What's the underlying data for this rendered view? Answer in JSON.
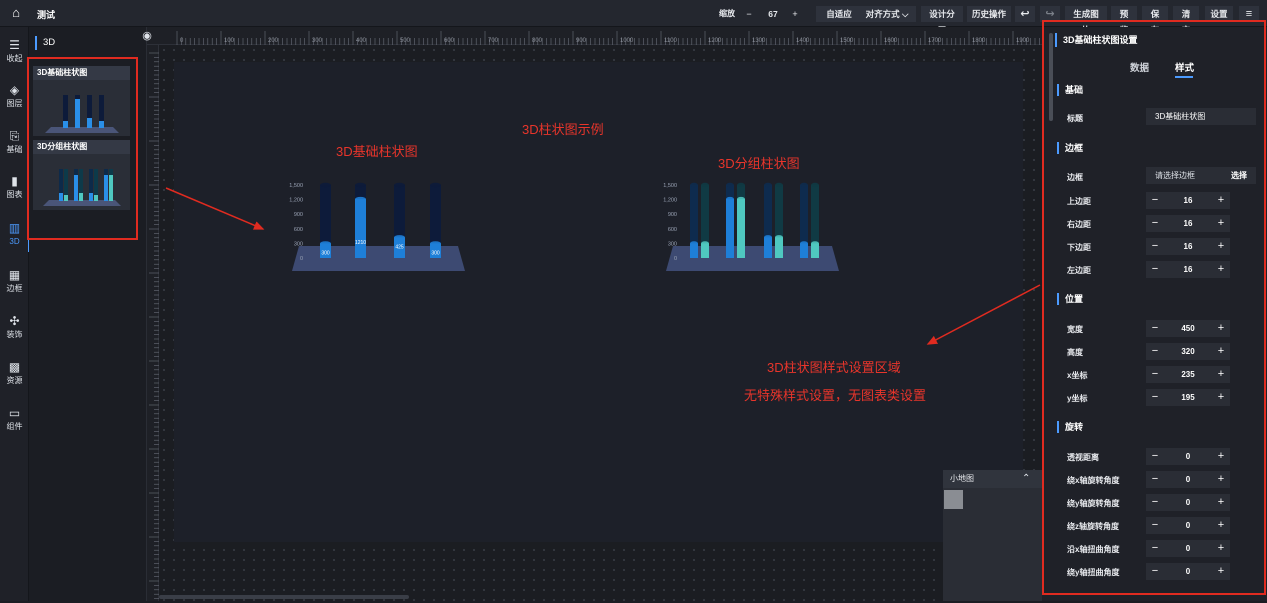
{
  "app": {
    "title": "测试"
  },
  "toolbar": {
    "zoom_label": "缩放",
    "zoom_minus": "−",
    "zoom_value": "67",
    "zoom_plus": "+",
    "fit": "自适应",
    "align": "对齐方式",
    "align_arrow": "⌵",
    "design_split": "设计分工",
    "history": "历史操作",
    "undo_glyph": "↩",
    "redo_glyph": "↪",
    "gen_image": "生成图片",
    "preview": "预览",
    "save": "保存",
    "clear": "清空",
    "settings": "设置",
    "menu_glyph": "≡"
  },
  "nav": [
    {
      "icon": "collapse-icon",
      "glyph": "☰",
      "label": "收起"
    },
    {
      "icon": "layers-icon",
      "glyph": "◈",
      "label": "图层"
    },
    {
      "icon": "basic-icon",
      "glyph": "⎘",
      "label": "基础"
    },
    {
      "icon": "chart-icon",
      "glyph": "▮",
      "label": "图表"
    },
    {
      "icon": "3d-icon",
      "glyph": "▥",
      "label": "3D"
    },
    {
      "icon": "border-icon",
      "glyph": "▦",
      "label": "边框"
    },
    {
      "icon": "decoration-icon",
      "glyph": "✣",
      "label": "装饰"
    },
    {
      "icon": "resource-icon",
      "glyph": "▩",
      "label": "资源"
    },
    {
      "icon": "component-icon",
      "glyph": "▭",
      "label": "组件"
    }
  ],
  "component_panel": {
    "heading": "3D",
    "cards": [
      {
        "title": "3D基础柱状图"
      },
      {
        "title": "3D分组柱状图"
      }
    ]
  },
  "ruler": {
    "top_ticks": [
      "0",
      "100",
      "200",
      "300",
      "400",
      "500",
      "600",
      "700",
      "800",
      "900",
      "1000",
      "1100",
      "1200",
      "1300",
      "1400",
      "1500",
      "1600",
      "1700",
      "1800",
      "1900"
    ]
  },
  "canvas": {
    "annotation_main": "3D柱状图示例",
    "label_basic": "3D基础柱状图",
    "label_grouped": "3D分组柱状图",
    "annotation_style_area": "3D柱状图样式设置区域",
    "annotation_note": "无特殊样式设置，无图表类设置"
  },
  "chart_data": [
    {
      "type": "bar",
      "categories": [
        "",
        "",
        "",
        ""
      ],
      "values": [
        300,
        1210,
        425,
        300
      ],
      "value_labels": [
        "300",
        "1210",
        "425",
        "300"
      ],
      "ylim": [
        0,
        1500
      ],
      "yticks": [
        "1,500",
        "1,200",
        "900",
        "600",
        "300",
        "0"
      ]
    },
    {
      "type": "bar",
      "categories": [
        "",
        "",
        "",
        ""
      ],
      "series": [
        {
          "values": [
            300,
            1210,
            425,
            300
          ]
        },
        {
          "values": [
            300,
            1210,
            425,
            300
          ]
        }
      ],
      "ylim": [
        0,
        1500
      ],
      "yticks": [
        "1,500",
        "1,200",
        "900",
        "600",
        "300",
        "0"
      ]
    }
  ],
  "minimap": {
    "title": "小地图",
    "toggle_glyph": "⌃"
  },
  "settings_panel": {
    "title": "3D基础柱状图设置",
    "tabs": [
      "数据",
      "样式"
    ],
    "sections": {
      "basic": "基础",
      "border": "边框",
      "position": "位置",
      "rotate": "旋转"
    },
    "basic": {
      "title_label": "标题",
      "title_value": "3D基础柱状图"
    },
    "border": {
      "border_label": "边框",
      "border_placeholder": "请选择边框",
      "select_button": "选择",
      "top_label": "上边距",
      "top_value": "16",
      "right_label": "右边距",
      "right_value": "16",
      "bottom_label": "下边距",
      "bottom_value": "16",
      "left_label": "左边距",
      "left_value": "16"
    },
    "position": {
      "width_label": "宽度",
      "width_value": "450",
      "height_label": "高度",
      "height_value": "320",
      "x_label": "x坐标",
      "x_value": "235",
      "y_label": "y坐标",
      "y_value": "195"
    },
    "rotate": {
      "persp_label": "透视距离",
      "persp_value": "0",
      "rx_label": "绕x轴旋转角度",
      "rx_value": "0",
      "ry_label": "绕y轴旋转角度",
      "ry_value": "0",
      "rz_label": "绕z轴旋转角度",
      "rz_value": "0",
      "skx_label": "沿x轴扭曲角度",
      "skx_value": "0",
      "sky_label": "绕y轴扭曲角度",
      "sky_value": "0"
    }
  },
  "colors": {
    "accent": "#4c9bff",
    "annotation_red": "#e8352b",
    "bar_blue": "#1e7fd8",
    "bar_teal": "#4fc8c0",
    "bar_empty": "#0d1b3a"
  }
}
